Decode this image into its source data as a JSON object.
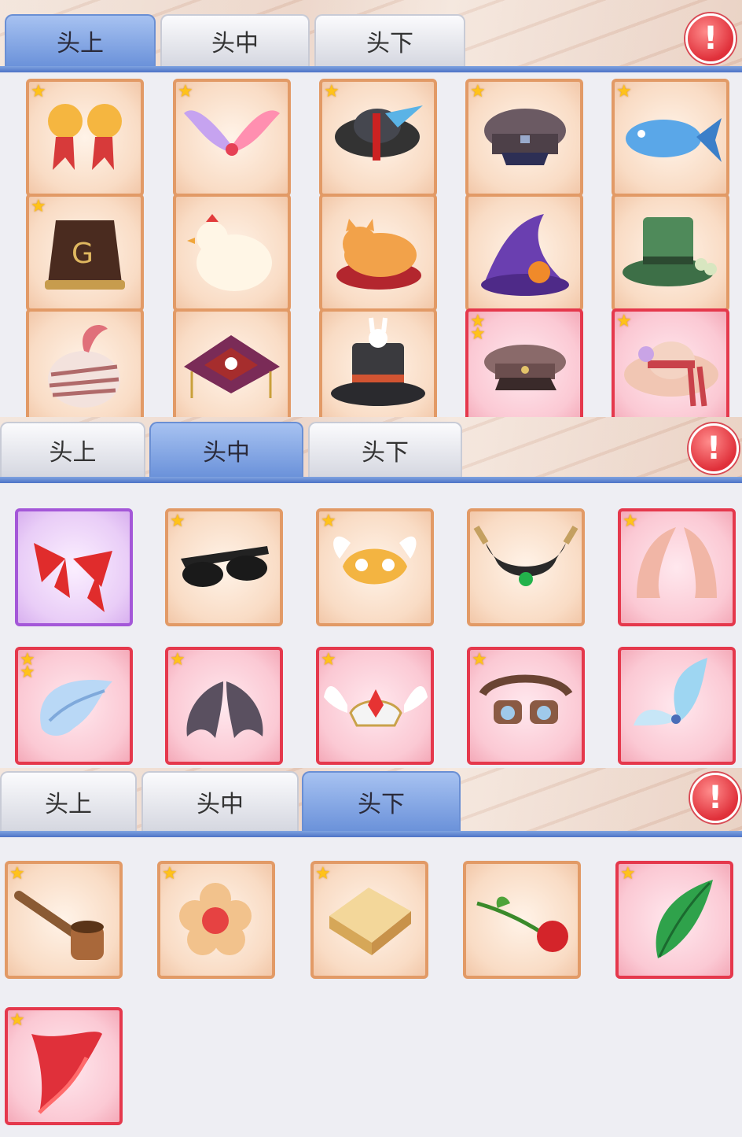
{
  "tabs": [
    "头上",
    "头中",
    "头下"
  ],
  "alert_icon": "!",
  "star_icon": "★",
  "colors": {
    "tab_active": "#6b92da",
    "card_orange": "#e29a66",
    "card_red": "#e5384c",
    "card_purple": "#a457d8",
    "star": "#ffc21a"
  },
  "panels": [
    {
      "active_tab": 0,
      "items": [
        {
          "icon": "golden-bells-icon",
          "rarity": "orange",
          "stars": 1
        },
        {
          "icon": "rainbow-wings-icon",
          "rarity": "orange",
          "stars": 1
        },
        {
          "icon": "qing-official-hat-icon",
          "rarity": "orange",
          "stars": 1
        },
        {
          "icon": "police-cap-icon",
          "rarity": "orange",
          "stars": 1
        },
        {
          "icon": "blue-fish-icon",
          "rarity": "orange",
          "stars": 1
        },
        {
          "icon": "fez-hat-icon",
          "rarity": "orange",
          "stars": 1
        },
        {
          "icon": "chicken-icon",
          "rarity": "orange",
          "stars": 0
        },
        {
          "icon": "sleeping-cat-icon",
          "rarity": "orange",
          "stars": 0
        },
        {
          "icon": "witch-hat-icon",
          "rarity": "orange",
          "stars": 0
        },
        {
          "icon": "green-top-hat-icon",
          "rarity": "orange",
          "stars": 0
        },
        {
          "icon": "turban-icon",
          "rarity": "orange",
          "stars": 0
        },
        {
          "icon": "taoist-hat-icon",
          "rarity": "orange",
          "stars": 0
        },
        {
          "icon": "magician-hat-rabbit-icon",
          "rarity": "orange",
          "stars": 0
        },
        {
          "icon": "officer-cap-icon",
          "rarity": "red",
          "stars": 2
        },
        {
          "icon": "flower-sun-hat-icon",
          "rarity": "red",
          "stars": 1
        }
      ]
    },
    {
      "active_tab": 1,
      "items": [
        {
          "icon": "red-bows-icon",
          "rarity": "purple",
          "stars": 0
        },
        {
          "icon": "sunglasses-icon",
          "rarity": "orange",
          "stars": 1
        },
        {
          "icon": "winged-mask-icon",
          "rarity": "orange",
          "stars": 1
        },
        {
          "icon": "horned-circlet-icon",
          "rarity": "orange",
          "stars": 0
        },
        {
          "icon": "elf-ears-icon",
          "rarity": "red",
          "stars": 1
        },
        {
          "icon": "ice-wings-icon",
          "rarity": "red",
          "stars": 2
        },
        {
          "icon": "bat-wings-icon",
          "rarity": "red",
          "stars": 1
        },
        {
          "icon": "winged-tiara-icon",
          "rarity": "red",
          "stars": 1
        },
        {
          "icon": "goggles-icon",
          "rarity": "red",
          "stars": 1
        },
        {
          "icon": "crystal-wings-icon",
          "rarity": "red",
          "stars": 0
        }
      ]
    },
    {
      "active_tab": 2,
      "items": [
        {
          "icon": "pipe-icon",
          "rarity": "orange",
          "stars": 1
        },
        {
          "icon": "flower-icon",
          "rarity": "orange",
          "stars": 1
        },
        {
          "icon": "toast-icon",
          "rarity": "orange",
          "stars": 1
        },
        {
          "icon": "rose-icon",
          "rarity": "orange",
          "stars": 0
        },
        {
          "icon": "leaf-icon",
          "rarity": "red",
          "stars": 1
        },
        {
          "icon": "red-scarf-icon",
          "rarity": "red",
          "stars": 1
        }
      ]
    }
  ]
}
